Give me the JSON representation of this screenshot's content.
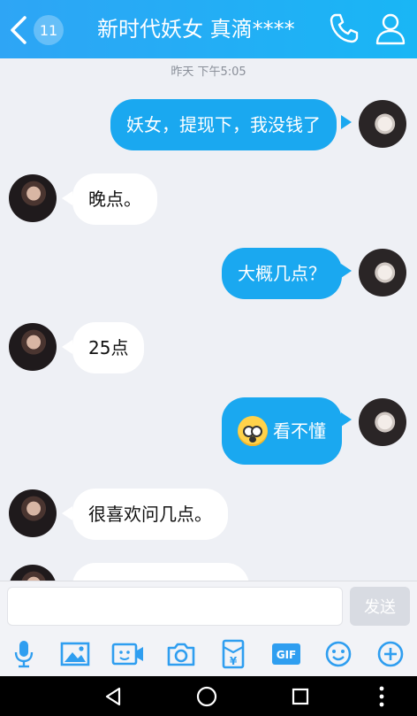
{
  "header": {
    "unread_count": "11",
    "title": "新时代妖女 真滴****"
  },
  "chat": {
    "timestamp": "昨天 下午5:05",
    "messages": [
      {
        "side": "right",
        "text": "妖女，提现下，我没钱了"
      },
      {
        "side": "left",
        "text": "晚点。"
      },
      {
        "side": "right",
        "text": "大概几点？"
      },
      {
        "side": "left",
        "text": "25点"
      },
      {
        "side": "right",
        "text": "看不懂",
        "emoji": "shocked-face-emoji"
      },
      {
        "side": "left",
        "text": "很喜欢问几点。"
      },
      {
        "side": "left",
        "text": ""
      }
    ]
  },
  "input_bar": {
    "value": "",
    "placeholder": "",
    "send_label": "发送"
  },
  "toolbar": {
    "items": [
      "microphone-icon",
      "image-icon",
      "video-icon",
      "camera-icon",
      "red-envelope-icon",
      "gif-icon",
      "emoji-icon",
      "plus-icon"
    ],
    "gif_label": "GIF"
  },
  "colors": {
    "header_blue": "#2ea5f5",
    "my_bubble": "#1aa8f0",
    "their_bubble": "#ffffff",
    "chat_bg": "#eef0f5",
    "icon_blue": "#2f9ef0"
  }
}
